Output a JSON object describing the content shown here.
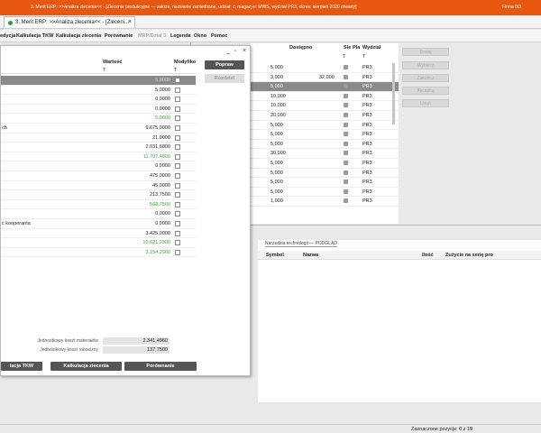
{
  "window": {
    "title": "3. Merit ERP: >>Analiza zlecenia<< - [Zlecenie produkcyjne — założe, nazwanie zaniedbane, udział: c, magazyn: MWS, wydział PR3, okres: sierpień 2020 otwarty]",
    "right_label": "Firma 0I3"
  },
  "tab": {
    "label": "3. Merit ERP: >>Analiza zlecenia<< - [Zleceni..."
  },
  "menu": {
    "items": [
      "edycja",
      "Kalkulacja TKW",
      "Kalkulacja zlecenia",
      "Porównanie",
      "MRP/Dział 3",
      "Legenda",
      "Okno",
      "Pomoc"
    ]
  },
  "dialog": {
    "headers": {
      "wartosc": "Wartość",
      "modyfikacja": "Modyfiko"
    },
    "filter_marker": "T",
    "rows": [
      {
        "label": "",
        "value": "5,0000"
      },
      {
        "label": "",
        "value": "5,0000"
      },
      {
        "label": "",
        "value": "0,0000"
      },
      {
        "label": "",
        "value": "0,0000"
      },
      {
        "label": "",
        "value": "5,0000"
      },
      {
        "label": "ch",
        "value": "9.675,0000"
      },
      {
        "label": "",
        "value": "21,0000"
      },
      {
        "label": "",
        "value": "2.031,6800"
      },
      {
        "label": "",
        "value": "11.707,4800"
      },
      {
        "label": "",
        "value": "0,0000"
      },
      {
        "label": "",
        "value": "475,0000"
      },
      {
        "label": "",
        "value": "45,0000"
      },
      {
        "label": "",
        "value": "213,7500"
      },
      {
        "label": "",
        "value": "568,7500"
      },
      {
        "label": "",
        "value": "0,0000"
      },
      {
        "label": "ć kooperanta",
        "value": "0,0000"
      },
      {
        "label": "",
        "value": "3.425,0000"
      },
      {
        "label": "",
        "value": "15.621,2300"
      },
      {
        "label": "",
        "value": "3.154,2960"
      }
    ],
    "buttons": {
      "popraw": "Popraw",
      "rozdziel": "Rozdziel"
    },
    "summary": {
      "mat_label": "Jednostkowy koszt materiałów",
      "mat_value": "2.341,4960",
      "rob_label": "Jednostkowy koszt robocizny",
      "rob_value": "137,7500"
    },
    "bottom_buttons": [
      "lacja TKW",
      "Kalkulacja zlecenia",
      "Porównanie"
    ]
  },
  "bg_grid": {
    "headers": {
      "dostepno": "Dostępno",
      "sle": "Sle",
      "pla": "Pla",
      "wydzial": "Wydział"
    },
    "filter_marker": "T",
    "rows": [
      {
        "left": "5,000",
        "mid": "",
        "wydzial": "PR3"
      },
      {
        "left": "3,000",
        "mid": "32,000",
        "wydzial": "PR3"
      },
      {
        "left": "5,000",
        "mid": "",
        "wydzial": "PR3"
      },
      {
        "left": "10,000",
        "mid": "",
        "wydzial": "PR3"
      },
      {
        "left": "10,000",
        "mid": "",
        "wydzial": "PR3"
      },
      {
        "left": "20,000",
        "mid": "",
        "wydzial": "PR3"
      },
      {
        "left": "5,000",
        "mid": "",
        "wydzial": "PR3"
      },
      {
        "left": "5,000",
        "mid": "",
        "wydzial": "PR3"
      },
      {
        "left": "5,000",
        "mid": "",
        "wydzial": "PR3"
      },
      {
        "left": "30,000",
        "mid": "",
        "wydzial": "PR3"
      },
      {
        "left": "5,000",
        "mid": "",
        "wydzial": "PR3"
      },
      {
        "left": "5,000",
        "mid": "",
        "wydzial": "PR3"
      },
      {
        "left": "5,000",
        "mid": "",
        "wydzial": "PR3"
      },
      {
        "left": "5,000",
        "mid": "",
        "wydzial": "PR3"
      },
      {
        "left": "1,000",
        "mid": "",
        "wydzial": "PR3"
      }
    ],
    "side_buttons": [
      "Dodaj",
      "Wybierz",
      "Zakończ",
      "Akceptuj",
      "Usuń"
    ]
  },
  "tech": {
    "tab": "Narzędzia technologii — PODGLĄD",
    "headers": {
      "symbol": "Symbol",
      "nazwa": "Nazwa",
      "ilosc": "Ilość",
      "zuzycie": "Zużycie na serię pro"
    }
  },
  "status": {
    "text": "Zaznaczone pozycje: 0 z 19"
  }
}
